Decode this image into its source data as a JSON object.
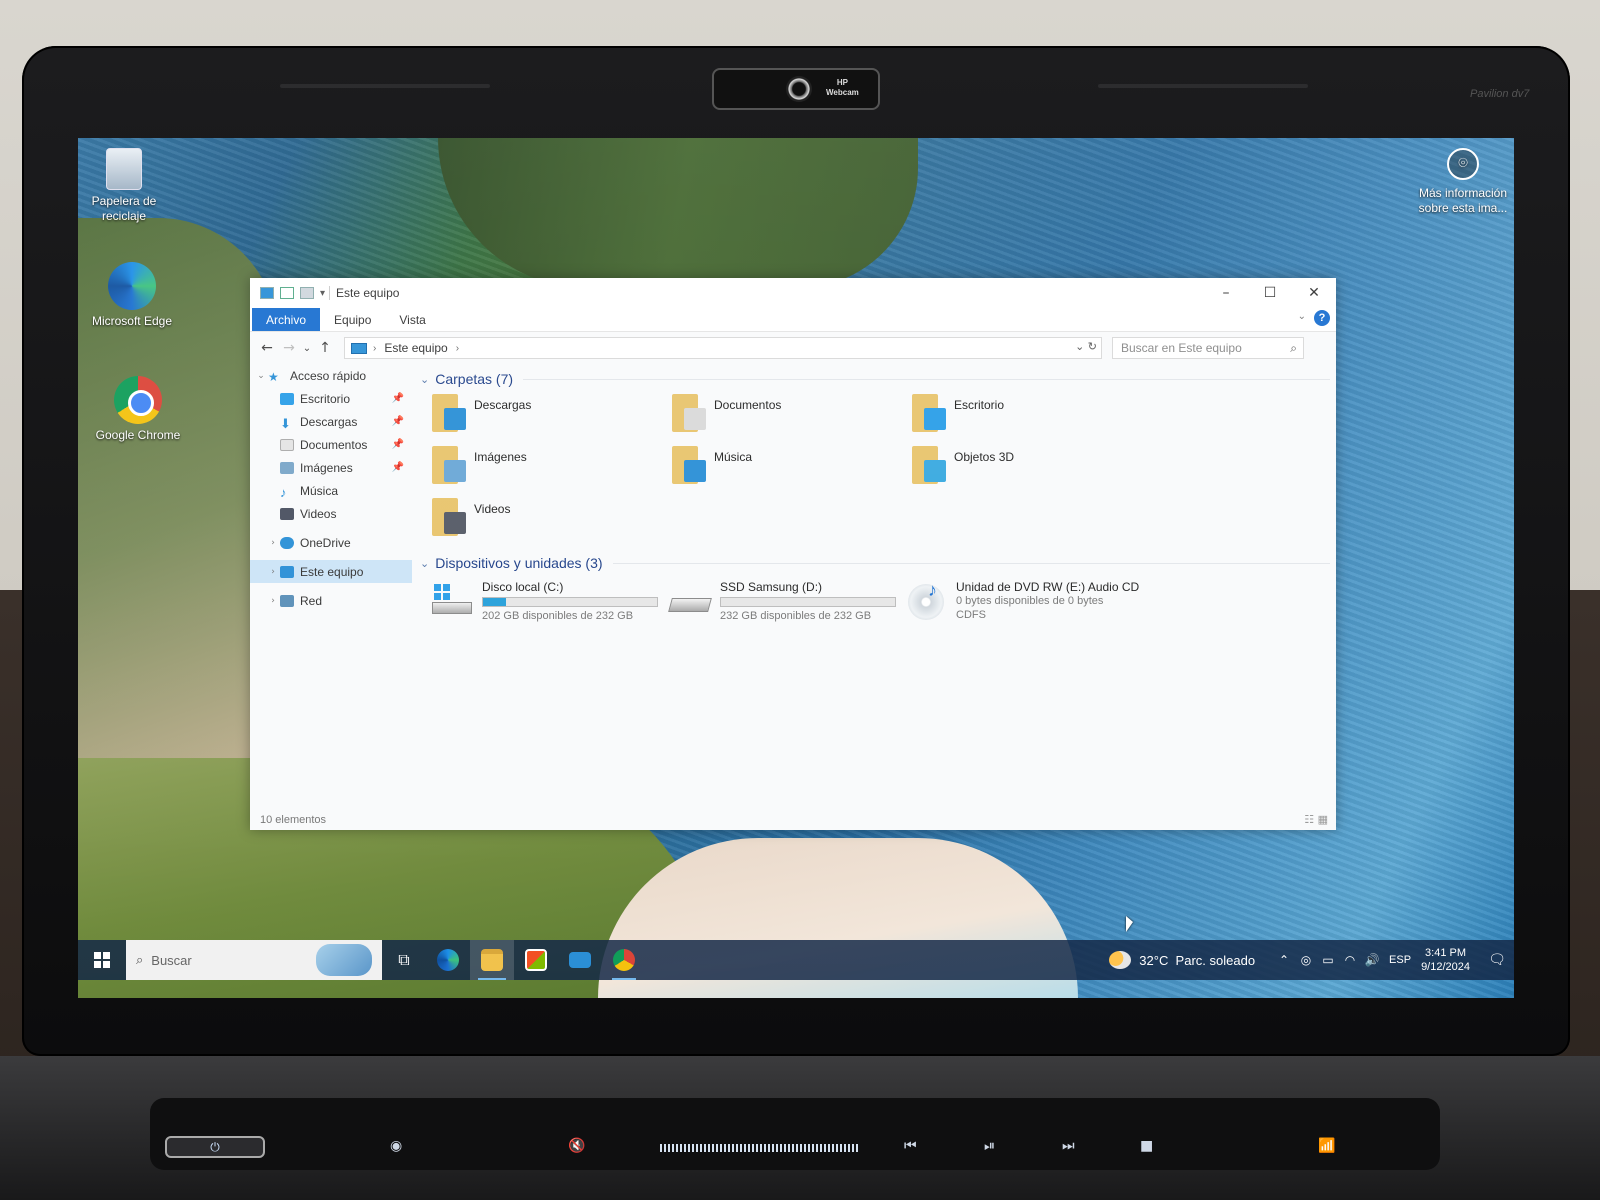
{
  "hardware": {
    "webcam_label": "HP\nWebcam",
    "model_label": "Pavilion dv7"
  },
  "desktop": {
    "icons": [
      {
        "label": "Papelera de reciclaje",
        "icon": "recycle-bin-icon"
      },
      {
        "label": "Microsoft Edge",
        "icon": "edge-icon"
      },
      {
        "label": "Google Chrome",
        "icon": "chrome-icon"
      }
    ],
    "info_label": "Más información sobre esta ima..."
  },
  "explorer": {
    "title": "Este equipo",
    "ribbon_tabs": [
      "Archivo",
      "Equipo",
      "Vista"
    ],
    "address": "Este equipo",
    "search_placeholder": "Buscar en Este equipo",
    "nav": {
      "quick_access": "Acceso rápido",
      "items": [
        "Escritorio",
        "Descargas",
        "Documentos",
        "Imágenes",
        "Música",
        "Videos"
      ],
      "onedrive": "OneDrive",
      "this_pc": "Este equipo",
      "network": "Red"
    },
    "folders_header": "Carpetas (7)",
    "folders": [
      {
        "name": "Descargas",
        "icon": "downloads-folder-icon",
        "color": "#2a8fd6"
      },
      {
        "name": "Documentos",
        "icon": "documents-folder-icon",
        "color": "#d9d9d9"
      },
      {
        "name": "Escritorio",
        "icon": "desktop-folder-icon",
        "color": "#2a9ee8"
      },
      {
        "name": "Imágenes",
        "icon": "pictures-folder-icon",
        "color": "#6aa7d6"
      },
      {
        "name": "Música",
        "icon": "music-folder-icon",
        "color": "#2a8fd6"
      },
      {
        "name": "Objetos 3D",
        "icon": "3d-objects-folder-icon",
        "color": "#38a9e0"
      },
      {
        "name": "Videos",
        "icon": "videos-folder-icon",
        "color": "#555a66"
      }
    ],
    "devices_header": "Dispositivos y unidades (3)",
    "drives": [
      {
        "name": "Disco local (C:)",
        "free": "202 GB disponibles de 232 GB",
        "used_fraction": 0.13,
        "icon": "windows-drive-icon"
      },
      {
        "name": "SSD Samsung (D:)",
        "free": "232 GB disponibles de 232 GB",
        "used_fraction": 0.0,
        "icon": "hard-drive-icon"
      },
      {
        "name": "Unidad de DVD RW (E:) Audio CD",
        "free": "0 bytes disponibles de 0 bytes",
        "fs": "CDFS",
        "icon": "audio-cd-icon"
      }
    ],
    "status": "10 elementos"
  },
  "taskbar": {
    "search_placeholder": "Buscar",
    "weather": "32°C  Parc. soleado",
    "language": "ESP",
    "time": "3:41 PM",
    "date": "9/12/2024"
  }
}
